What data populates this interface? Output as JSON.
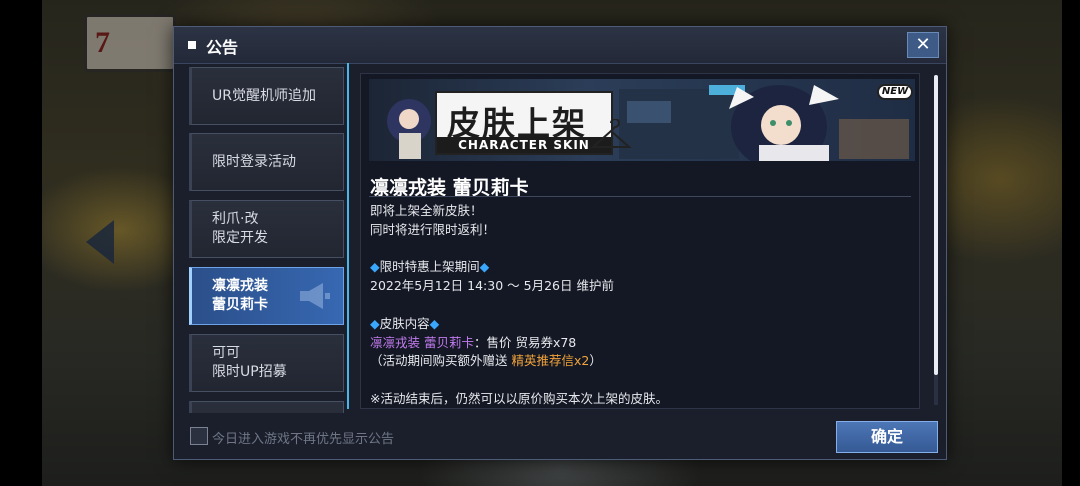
{
  "dialog": {
    "title": "公告",
    "close_label": "✕",
    "dont_show_label": "今日进入游戏不再优先显示公告",
    "confirm_label": "确定"
  },
  "sidebar": {
    "items": [
      {
        "line1": "UR觉醒机师追加",
        "line2": ""
      },
      {
        "line1": "限时登录活动",
        "line2": ""
      },
      {
        "line1": "利爪·改",
        "line2": "限定开发"
      },
      {
        "line1": "凛凛戎装",
        "line2": "蕾贝莉卡",
        "active": true
      },
      {
        "line1": "可可",
        "line2": "限时UP招募"
      }
    ]
  },
  "content": {
    "banner": {
      "title": "皮肤上架",
      "subtitle": "CHARACTER SKIN",
      "badge": "NEW"
    },
    "skin_title": "凛凛戎装 蕾贝莉卡",
    "lines": {
      "l1": "即将上架全新皮肤！",
      "l2": "同时将进行限时返利！",
      "sec1_head": "限时特惠上架期间",
      "sec1_body": "2022年5月12日 14:30 ～ 5月26日 维护前",
      "sec2_head": "皮肤内容",
      "skin_name": "凛凛戎装 蕾贝莉卡",
      "skin_price": "：售价 贸易券x78",
      "bonus_prefix": "（活动期间购买额外赠送 ",
      "bonus_item": "精英推荐信x2",
      "bonus_suffix": "）",
      "note": "※活动结束后，仍然可以以原价购买本次上架的皮肤。"
    }
  },
  "colors": {
    "accent": "#48b6e8",
    "highlight_purple": "#c37cf0",
    "highlight_orange": "#f2a33a",
    "active_tab": "#3768b2"
  },
  "icons": {
    "diamond": "◆",
    "megaphone": "megaphone-icon"
  }
}
